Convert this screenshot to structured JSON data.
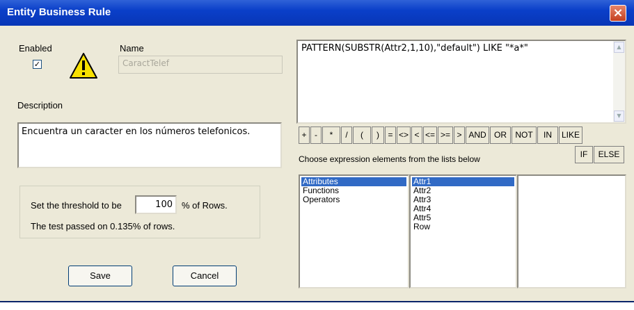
{
  "window": {
    "title": "Entity Business Rule",
    "close_glyph": "×"
  },
  "enabled": {
    "label": "Enabled",
    "checked": true,
    "check_mark": "✓"
  },
  "name": {
    "label": "Name",
    "value": "CaractTelef"
  },
  "description": {
    "label": "Description",
    "value": "Encuentra un caracter en los números telefonicos."
  },
  "threshold": {
    "prefix": "Set the threshold to be",
    "value": "100",
    "suffix": "% of Rows.",
    "result": "The test passed on 0.135% of rows."
  },
  "buttons": {
    "save": "Save",
    "cancel": "Cancel"
  },
  "expression": {
    "value": "PATTERN(SUBSTR(Attr2,1,10),\"default\")  LIKE  \"*a*\""
  },
  "operators": [
    "+",
    "-",
    "*",
    "/",
    "(",
    ")",
    "=",
    "<>",
    "<",
    "<=",
    ">=",
    ">",
    "AND",
    "OR",
    "NOT",
    "IN",
    "LIKE"
  ],
  "operators_row2": [
    "IF",
    "ELSE"
  ],
  "hint": "Choose expression elements from the lists below",
  "lists": {
    "categories": [
      "Attributes",
      "Functions",
      "Operators"
    ],
    "selected_category": "Attributes",
    "elements": [
      "Attr1",
      "Attr2",
      "Attr3",
      "Attr4",
      "Attr5",
      "Row"
    ],
    "selected_element": "Attr1",
    "details": []
  },
  "icons": {
    "warning": "warning-icon",
    "close": "close-icon",
    "scroll_up": "scroll-up-icon",
    "scroll_down": "scroll-down-icon"
  }
}
